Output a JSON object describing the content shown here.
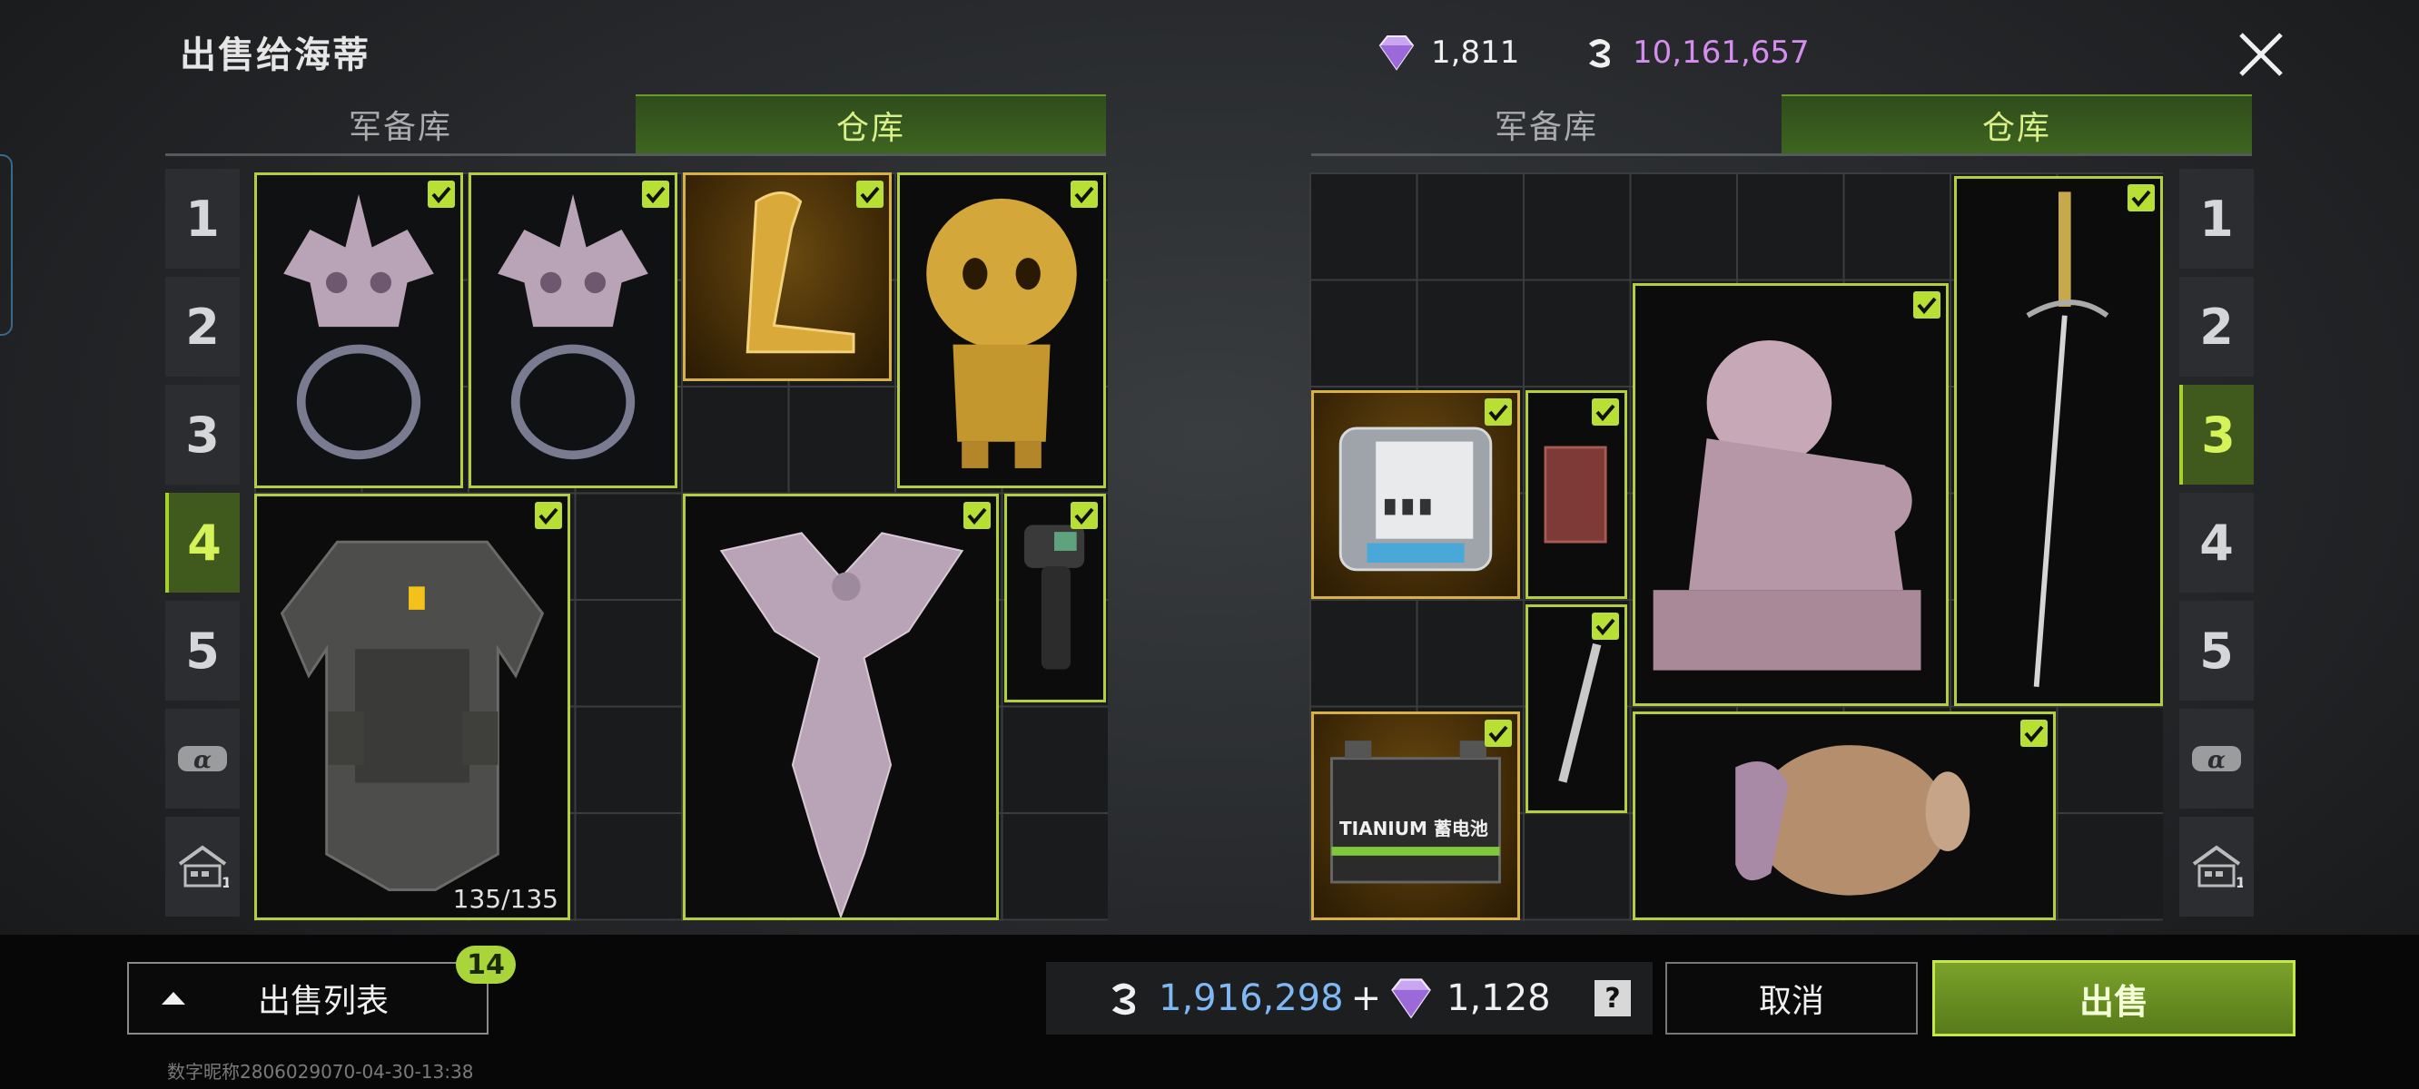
{
  "header": {
    "title": "出售给海蒂",
    "diamond_balance": "1,811",
    "coin_balance": "10,161,657",
    "close_icon": "close-icon"
  },
  "left_panel": {
    "tabs": [
      "军备库",
      "仓库"
    ],
    "active_tab": "仓库",
    "pages": [
      "1",
      "2",
      "3",
      "4",
      "5"
    ],
    "active_page": "4",
    "items": [
      {
        "name": "铺首衔环",
        "icon": "door-knocker-icon",
        "selected": true
      },
      {
        "name": "铺首衔环",
        "icon": "door-knocker-icon",
        "selected": true
      },
      {
        "name": "金蛇",
        "icon": "golden-snake-icon",
        "selected": true
      },
      {
        "name": "金木乃伊",
        "icon": "golden-mummy-icon",
        "selected": true
      },
      {
        "name": "防弹衣",
        "icon": "body-armor-icon",
        "selected": true,
        "durability": "135/135"
      },
      {
        "name": "凤凰雕像",
        "icon": "phoenix-statue-icon",
        "selected": true
      },
      {
        "name": "测温枪",
        "icon": "thermometer-gun-icon",
        "selected": true
      }
    ]
  },
  "right_panel": {
    "tabs": [
      "军备库",
      "仓库"
    ],
    "active_tab": "仓库",
    "pages": [
      "1",
      "2",
      "3",
      "4",
      "5"
    ],
    "active_page": "3",
    "items": [
      {
        "name": "储能电源",
        "icon": "power-station-icon",
        "selected": true
      },
      {
        "name": "书本",
        "icon": "book-icon",
        "selected": true
      },
      {
        "name": "石狮",
        "icon": "lion-statue-icon",
        "selected": true
      },
      {
        "name": "佩剑",
        "icon": "rapier-icon",
        "selected": true
      },
      {
        "name": "手术刀",
        "icon": "scalpel-icon",
        "selected": true
      },
      {
        "name": "蓄电池",
        "icon": "car-battery-icon",
        "selected": true,
        "label": "TIANIUM 蓄电池"
      },
      {
        "name": "陶罐",
        "icon": "vase-icon",
        "selected": true
      }
    ]
  },
  "footer": {
    "sell_list_label": "出售列表",
    "sell_count": "14",
    "coin_total": "1,916,298",
    "plus": "+",
    "diamond_total": "1,128",
    "help": "?",
    "cancel_label": "取消",
    "sell_label": "出售",
    "player_id": "数字昵称2806029070-04-30-13:38"
  },
  "colors": {
    "accent": "#b8e034",
    "coin_text": "#d58ef0",
    "coin_total_text": "#7fb8f5",
    "gold_cell": "#3d2806"
  }
}
